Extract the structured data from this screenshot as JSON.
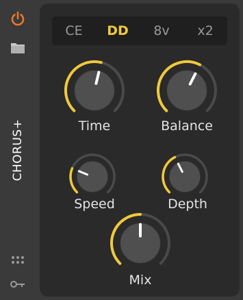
{
  "device": {
    "name": "CHORUS+"
  },
  "sidebar": {
    "power_icon": "power-icon",
    "folder_icon": "folder-icon",
    "grid_icon": "grid-dots-icon",
    "key_icon": "key-icon"
  },
  "modes": {
    "tabs": [
      "CE",
      "DD",
      "8v",
      "x2"
    ],
    "selected": "DD"
  },
  "knobs": [
    {
      "id": "time",
      "label": "Time",
      "value": 0.55
    },
    {
      "id": "balance",
      "label": "Balance",
      "value": 0.6
    },
    {
      "id": "speed",
      "label": "Speed",
      "value": 0.25
    },
    {
      "id": "depth",
      "label": "Depth",
      "value": 0.4
    },
    {
      "id": "mix",
      "label": "Mix",
      "value": 0.5
    }
  ],
  "colors": {
    "accent": "#f0c93c",
    "power": "#e8772e",
    "track": "#4a4a4a",
    "knob": "#4f4f4f"
  }
}
